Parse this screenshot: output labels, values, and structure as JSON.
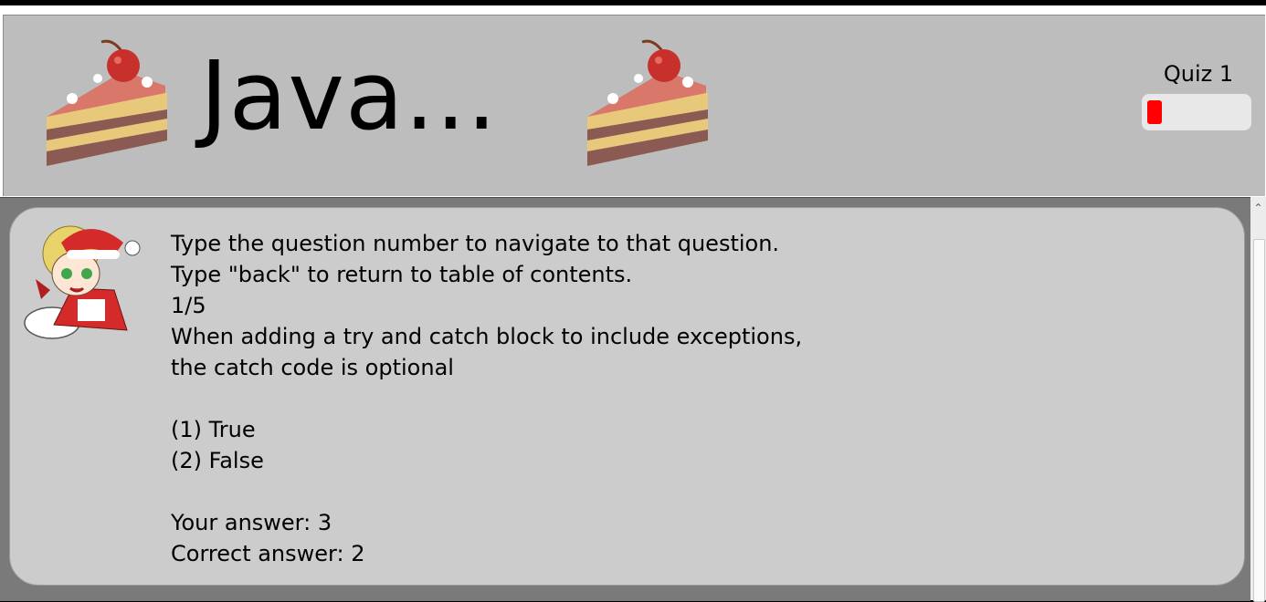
{
  "header": {
    "title": "Java...",
    "quiz_label": "Quiz 1",
    "progress": 0.15,
    "progress_color": "#ff0000"
  },
  "content": {
    "lines": [
      "Type the question number to navigate to that question.",
      "Type \"back\" to return to table of contents.",
      "1/5",
      "When adding a try and catch block to include exceptions,",
      "the catch code is optional",
      "",
      "(1) True",
      "(2) False",
      "",
      "Your answer: 3",
      "Correct answer: 2"
    ]
  },
  "icons": {
    "cake_left": "cake-slice-icon",
    "cake_right": "cake-slice-icon",
    "avatar": "santa-character-avatar",
    "scroll_up": "chevron-up-icon"
  },
  "colors": {
    "header_bg": "#bdbdbd",
    "card_bg": "#cccccc",
    "main_bg": "#7a7a7a"
  }
}
